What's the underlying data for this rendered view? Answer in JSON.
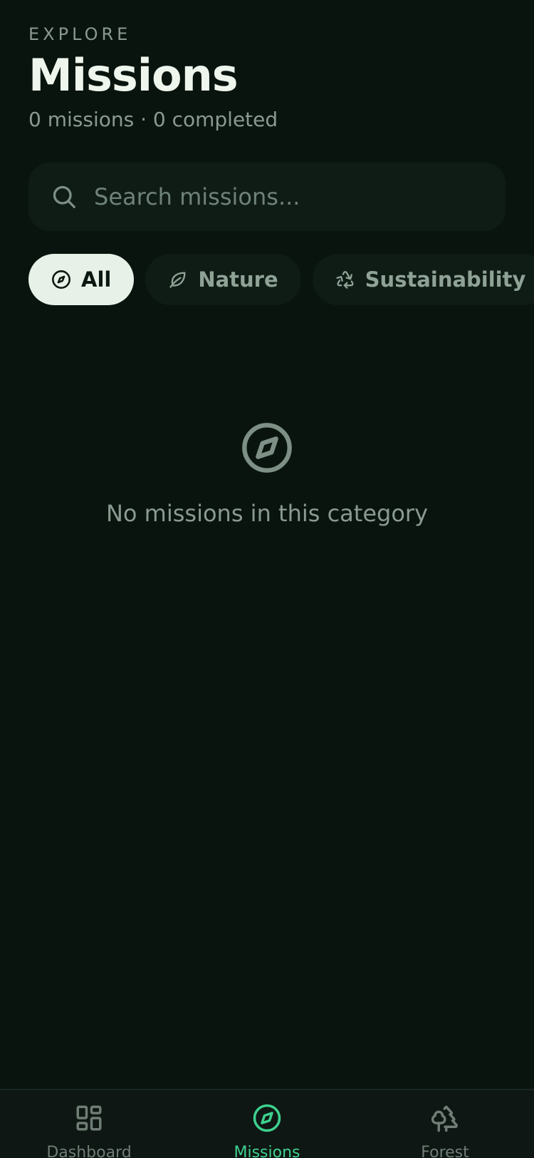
{
  "header": {
    "eyebrow": "EXPLORE",
    "title": "Missions",
    "subtitle": "0 missions · 0 completed"
  },
  "search": {
    "placeholder": "Search missions...",
    "value": "",
    "icon": "search-icon"
  },
  "filters": [
    {
      "label": "All",
      "icon": "compass-icon",
      "active": true
    },
    {
      "label": "Nature",
      "icon": "leaf-icon",
      "active": false
    },
    {
      "label": "Sustainability",
      "icon": "recycle-icon",
      "active": false
    }
  ],
  "empty_state": {
    "icon": "compass-icon",
    "message": "No missions in this category"
  },
  "nav": [
    {
      "label": "Dashboard",
      "icon": "dashboard-icon",
      "active": false
    },
    {
      "label": "Missions",
      "icon": "compass-icon",
      "active": true
    },
    {
      "label": "Forest",
      "icon": "trees-icon",
      "active": false
    }
  ],
  "colors": {
    "background": "#09140f",
    "surface": "#0f1c16",
    "accent": "#3ed08f",
    "active_chip": "#e8f1e7",
    "muted_text": "#8a9a90"
  }
}
